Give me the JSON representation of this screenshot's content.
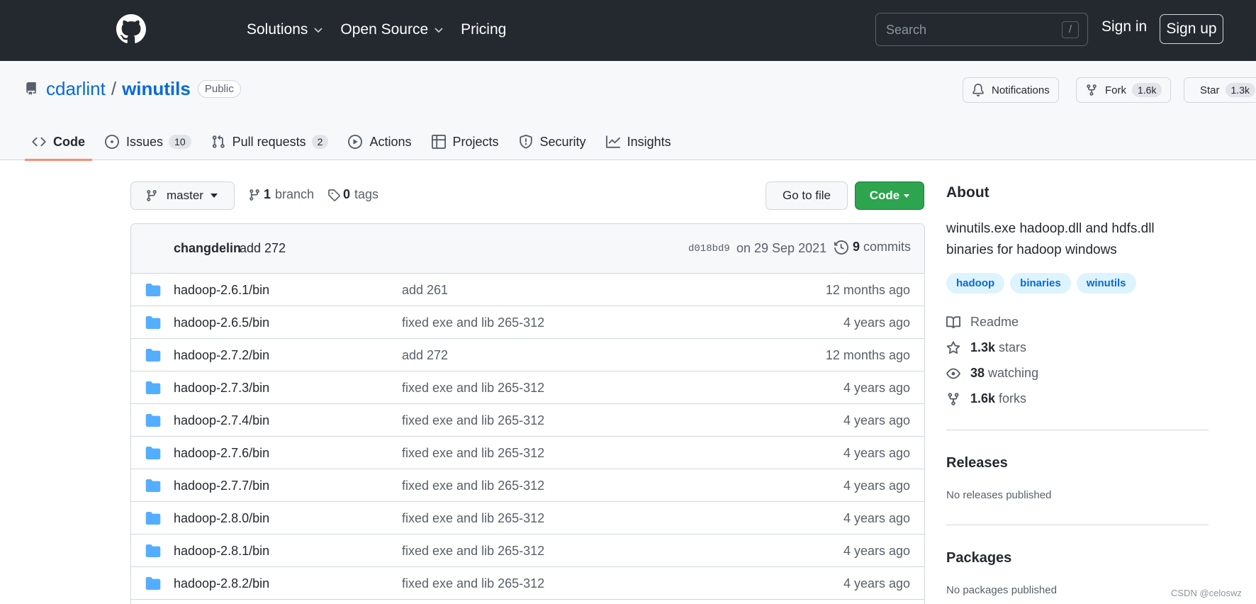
{
  "header": {
    "nav": [
      {
        "label": "Solutions",
        "dropdown": true
      },
      {
        "label": "Open Source",
        "dropdown": true
      },
      {
        "label": "Pricing",
        "dropdown": false
      }
    ],
    "search_placeholder": "Search",
    "search_shortcut": "/",
    "signin": "Sign in",
    "signup": "Sign up"
  },
  "repo": {
    "owner": "cdarlint",
    "separator": "/",
    "name": "winutils",
    "visibility": "Public",
    "notifications": "Notifications",
    "fork_label": "Fork",
    "fork_count": "1.6k",
    "star_label": "Star",
    "star_count": "1.3k"
  },
  "tabs": [
    {
      "label": "Code",
      "icon": "code-icon",
      "active": true,
      "count": ""
    },
    {
      "label": "Issues",
      "icon": "issue-icon",
      "active": false,
      "count": "10"
    },
    {
      "label": "Pull requests",
      "icon": "pull-request-icon",
      "active": false,
      "count": "2"
    },
    {
      "label": "Actions",
      "icon": "play-icon",
      "active": false,
      "count": ""
    },
    {
      "label": "Projects",
      "icon": "table-icon",
      "active": false,
      "count": ""
    },
    {
      "label": "Security",
      "icon": "shield-icon",
      "active": false,
      "count": ""
    },
    {
      "label": "Insights",
      "icon": "graph-icon",
      "active": false,
      "count": ""
    }
  ],
  "toolbar": {
    "branch": "master",
    "branch_count": "1",
    "branch_label": "branch",
    "tag_count": "0",
    "tag_label": "tags",
    "go_to_file": "Go to file",
    "code": "Code"
  },
  "commit": {
    "author": "changdelin",
    "message": "add 272",
    "hash": "d018bd9",
    "date": "on 29 Sep 2021",
    "count": "9",
    "count_label": "commits"
  },
  "files": [
    {
      "name": "hadoop-2.6.1/bin",
      "message": "add 261",
      "age": "12 months ago"
    },
    {
      "name": "hadoop-2.6.5/bin",
      "message": "fixed exe and lib 265-312",
      "age": "4 years ago"
    },
    {
      "name": "hadoop-2.7.2/bin",
      "message": "add 272",
      "age": "12 months ago"
    },
    {
      "name": "hadoop-2.7.3/bin",
      "message": "fixed exe and lib 265-312",
      "age": "4 years ago"
    },
    {
      "name": "hadoop-2.7.4/bin",
      "message": "fixed exe and lib 265-312",
      "age": "4 years ago"
    },
    {
      "name": "hadoop-2.7.6/bin",
      "message": "fixed exe and lib 265-312",
      "age": "4 years ago"
    },
    {
      "name": "hadoop-2.7.7/bin",
      "message": "fixed exe and lib 265-312",
      "age": "4 years ago"
    },
    {
      "name": "hadoop-2.8.0/bin",
      "message": "fixed exe and lib 265-312",
      "age": "4 years ago"
    },
    {
      "name": "hadoop-2.8.1/bin",
      "message": "fixed exe and lib 265-312",
      "age": "4 years ago"
    },
    {
      "name": "hadoop-2.8.2/bin",
      "message": "fixed exe and lib 265-312",
      "age": "4 years ago"
    }
  ],
  "about": {
    "title": "About",
    "description": "winutils.exe hadoop.dll and hdfs.dll binaries for hadoop windows",
    "topics": [
      "hadoop",
      "binaries",
      "winutils"
    ],
    "readme": "Readme",
    "stars_count": "1.3k",
    "stars_label": "stars",
    "watching_count": "38",
    "watching_label": "watching",
    "forks_count": "1.6k",
    "forks_label": "forks"
  },
  "releases": {
    "title": "Releases",
    "note": "No releases published"
  },
  "packages": {
    "title": "Packages",
    "note": "No packages published"
  },
  "watermark": "CSDN @celoswz",
  "colors": {
    "header_bg": "#24292f",
    "link": "#0969da",
    "code_button": "#2da44e",
    "active_tab": "#fd8c73",
    "folder": "#54aeff"
  }
}
